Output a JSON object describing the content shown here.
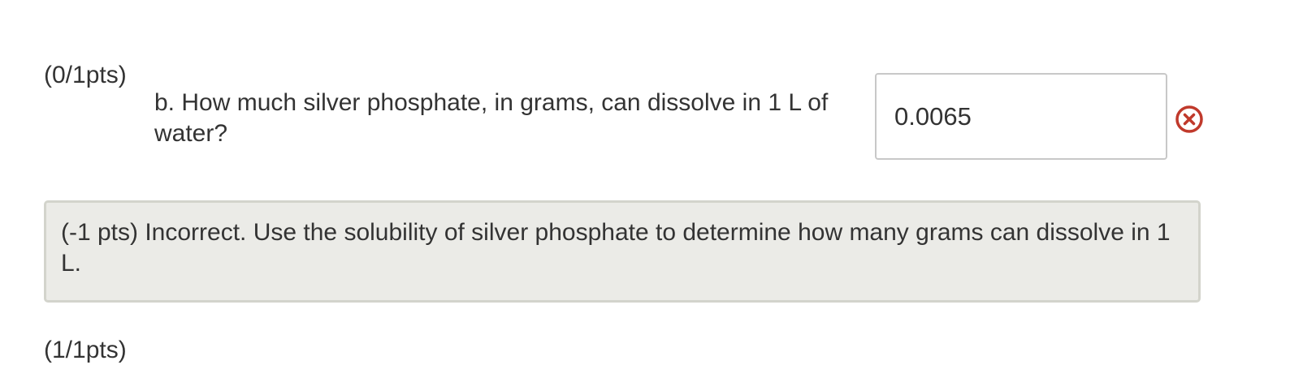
{
  "question": {
    "points_label": "(0/1pts)",
    "text": "b. How much silver phosphate, in grams, can dissolve in 1 L of water?",
    "answer_value": "0.0065",
    "status_icon": "incorrect-x-circle",
    "status_color": "#c0392b"
  },
  "feedback": {
    "text": "(-1 pts) Incorrect. Use the solubility of silver phosphate to determine how many grams can dissolve in 1 L."
  },
  "next_question": {
    "points_label": "(1/1pts)"
  },
  "colors": {
    "feedback_background": "#ebebe7",
    "feedback_border": "#d3d4cc",
    "input_border": "#c8c8c8",
    "text": "#333333"
  }
}
